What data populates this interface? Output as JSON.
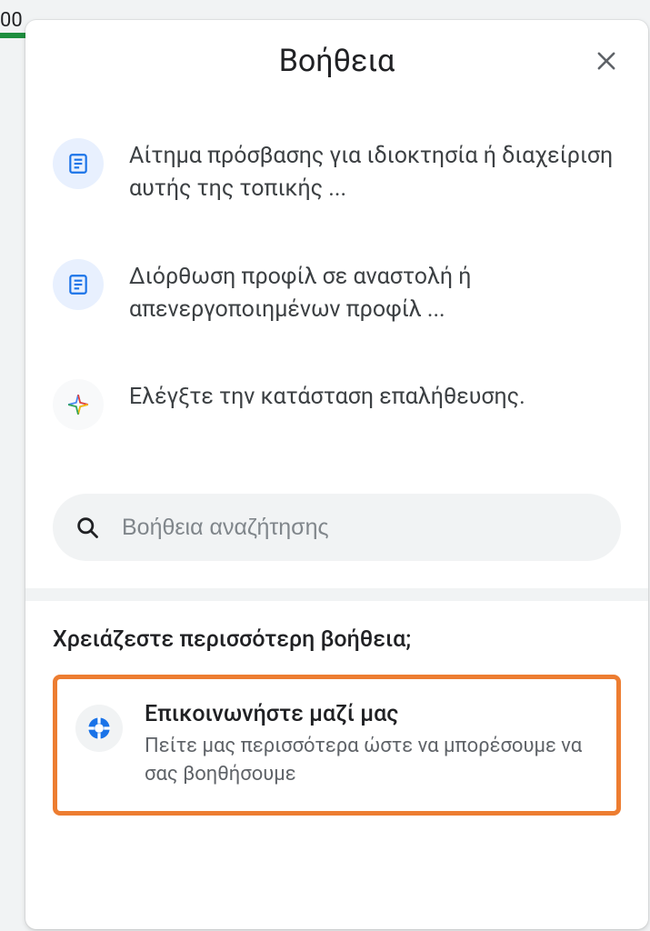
{
  "background": {
    "partial_text": "00"
  },
  "panel": {
    "title": "Βοήθεια",
    "list": {
      "items": [
        {
          "icon": "article-icon",
          "label": "Αίτημα πρόσβασης για ιδιοκτησία ή διαχείριση αυτής της τοπικής ..."
        },
        {
          "icon": "article-icon",
          "label": "Διόρθωση προφίλ σε αναστολή ή απενεργοποιημένων προφίλ ..."
        },
        {
          "icon": "sparkle-icon",
          "label": "Ελέγξτε την κατάσταση επαλήθευσης."
        }
      ]
    },
    "search": {
      "placeholder": "Βοήθεια αναζήτησης"
    },
    "more_help": {
      "title": "Χρειάζεστε περισσότερη βοήθεια;",
      "contact": {
        "title": "Επικοινωνήστε μαζί μας",
        "subtitle": "Πείτε μας περισσότερα ώστε να μπορέσουμε να σας βοηθήσουμε"
      }
    }
  }
}
